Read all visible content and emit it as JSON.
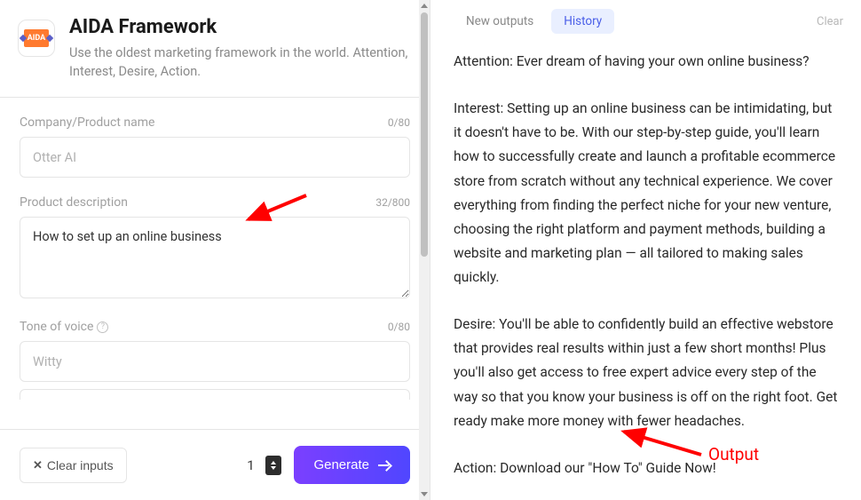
{
  "header": {
    "title": "AIDA Framework",
    "subtitle": "Use the oldest marketing framework in the world. Attention, Interest, Desire, Action.",
    "icon_text": "AIDA"
  },
  "form": {
    "company": {
      "label": "Company/Product name",
      "count": "0/80",
      "placeholder": "Otter AI",
      "value": ""
    },
    "description": {
      "label": "Product description",
      "count": "32/800",
      "value": "How to set up an online business"
    },
    "tone": {
      "label": "Tone of voice",
      "count": "0/80",
      "placeholder": "Witty",
      "value": ""
    }
  },
  "controls": {
    "clear_label": "Clear inputs",
    "quantity": "1",
    "generate_label": "Generate"
  },
  "tabs": {
    "new_outputs": "New outputs",
    "history": "History",
    "clear": "Clear"
  },
  "output": {
    "attention": "Attention: Ever dream of having your own online business?",
    "interest": "Interest: Setting up an online business can be intimidating, but it doesn't have to be. With our step-by-step guide, you'll learn how to successfully create and launch a profitable ecommerce store from scratch without any technical experience. We cover everything from finding the perfect niche for your new venture, choosing the right platform and payment methods, building a website and marketing plan — all tailored to making sales quickly.",
    "desire": "Desire: You'll be able to confidently build an effective webstore that provides real results within just a few short months! Plus you'll also get access to free expert advice every step of the way so that you know your business is off on the right foot. Get ready make more money with fewer headaches.",
    "action": "Action: Download our \"How To\" Guide Now!"
  },
  "annotations": {
    "output_label": "Output"
  }
}
